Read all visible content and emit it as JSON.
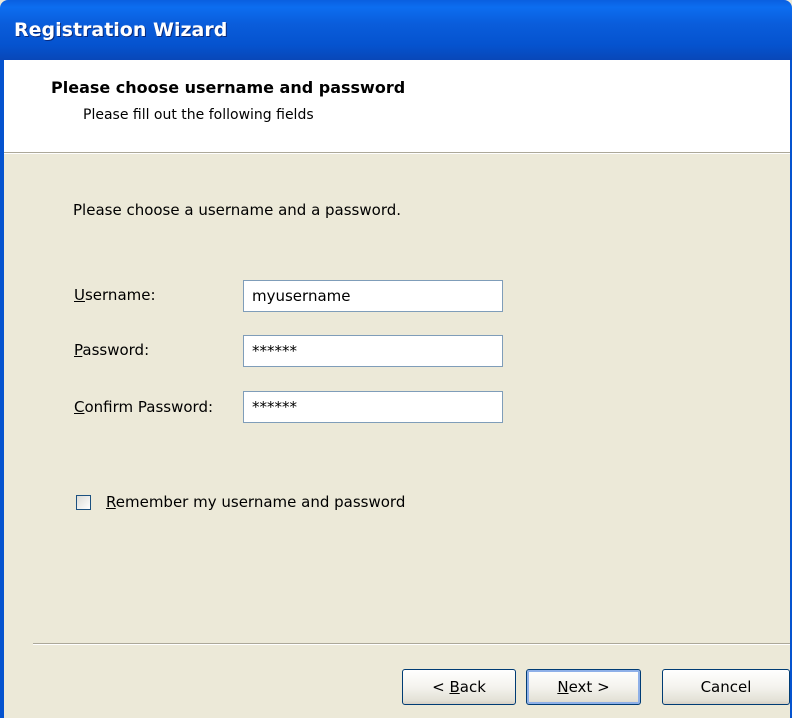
{
  "window": {
    "title": "Registration Wizard"
  },
  "header": {
    "heading": "Please choose username and password",
    "subheading": "Please fill out the following fields"
  },
  "body": {
    "instruction": "Please choose a username and a password."
  },
  "fields": {
    "username": {
      "label_mnemonic": "U",
      "label_rest": "sername:",
      "value": "myusername"
    },
    "password": {
      "label_mnemonic": "P",
      "label_rest": "assword:",
      "value": "******"
    },
    "confirm_password": {
      "label_mnemonic": "C",
      "label_rest": "onfirm Password:",
      "value": "******"
    }
  },
  "remember": {
    "checked": false,
    "label_mnemonic": "R",
    "label_rest": "emember my username and password"
  },
  "buttons": {
    "back": {
      "prefix": "< ",
      "mnemonic": "B",
      "rest": "ack"
    },
    "next": {
      "mnemonic": "N",
      "rest": "ext >"
    },
    "cancel": {
      "label": "Cancel"
    }
  },
  "colors": {
    "titlebar": "#0553cf",
    "dialog_bg": "#ece9d8",
    "header_bg": "#ffffff",
    "input_border": "#7f9db9"
  }
}
